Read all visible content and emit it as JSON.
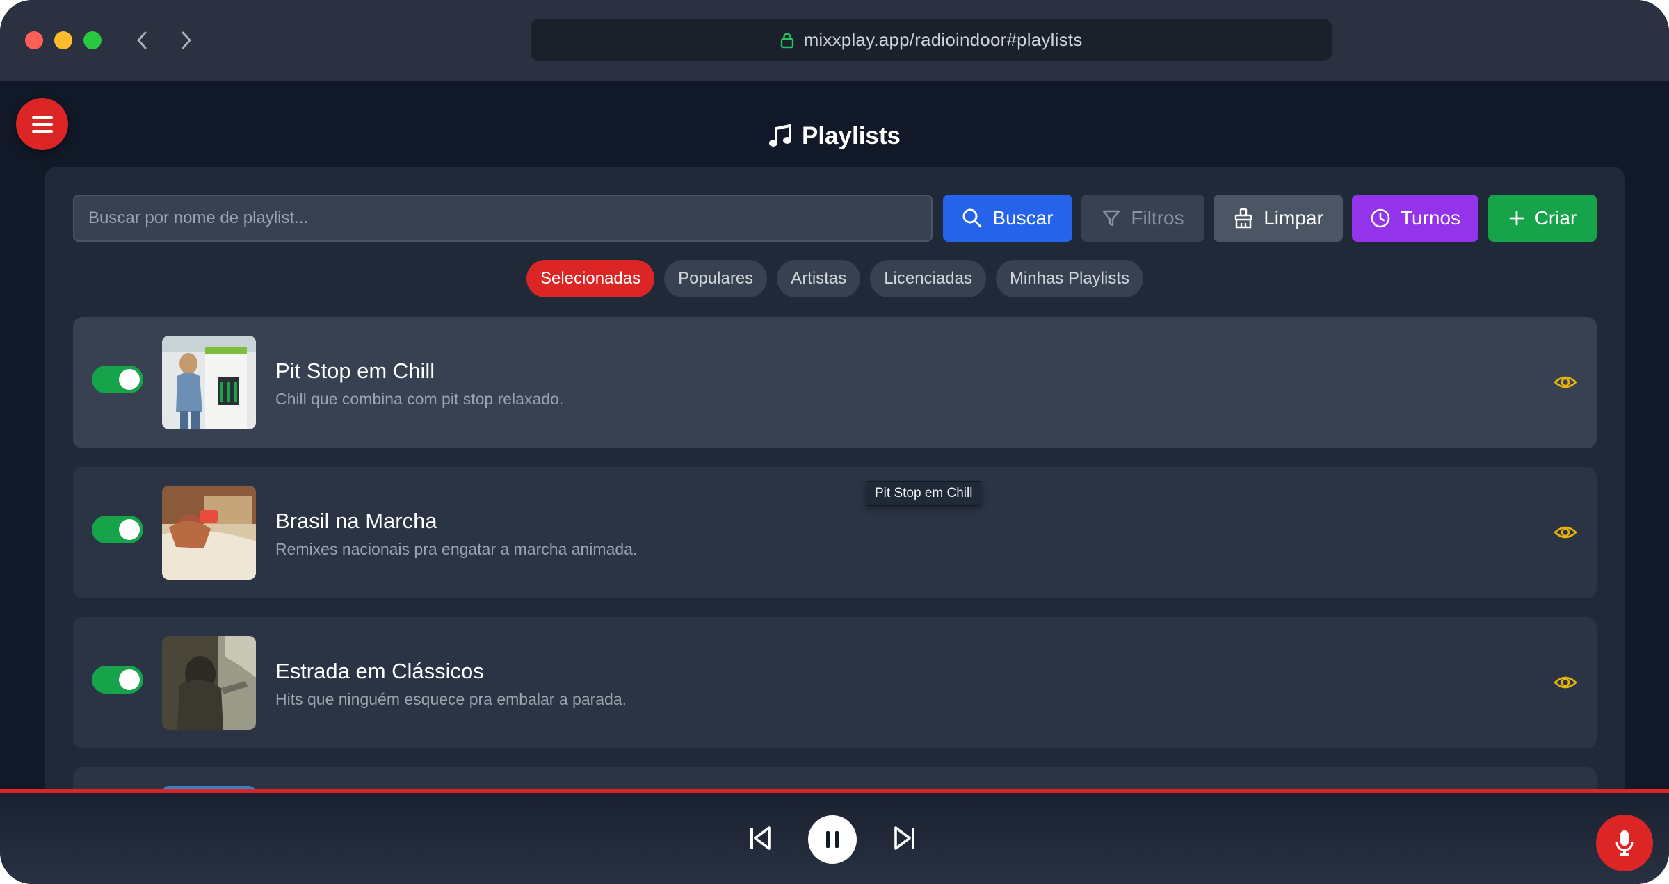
{
  "browser": {
    "url": "mixxplay.app/radioindoor#playlists"
  },
  "page": {
    "title": "Playlists"
  },
  "toolbar": {
    "search_placeholder": "Buscar por nome de playlist...",
    "buscar_label": "Buscar",
    "filtros_label": "Filtros",
    "limpar_label": "Limpar",
    "turnos_label": "Turnos",
    "criar_label": "Criar"
  },
  "tabs": [
    {
      "label": "Selecionadas",
      "active": true
    },
    {
      "label": "Populares",
      "active": false
    },
    {
      "label": "Artistas",
      "active": false
    },
    {
      "label": "Licenciadas",
      "active": false
    },
    {
      "label": "Minhas Playlists",
      "active": false
    }
  ],
  "playlists": [
    {
      "title": "Pit Stop em Chill",
      "description": "Chill que combina com pit stop relaxado.",
      "enabled": true
    },
    {
      "title": "Brasil na Marcha",
      "description": "Remixes nacionais pra engatar a marcha animada.",
      "enabled": true
    },
    {
      "title": "Estrada em Clássicos",
      "description": "Hits que ninguém esquece pra embalar a parada.",
      "enabled": true
    }
  ],
  "tooltip": {
    "text": "Pit Stop em Chill"
  },
  "icons": {
    "menu": "hamburger-icon",
    "title": "music-note-icon",
    "buscar": "search-icon",
    "filtros": "filter-icon",
    "limpar": "broom-icon",
    "turnos": "clock-icon",
    "criar": "plus-icon",
    "view": "eye-icon",
    "prev": "skip-back-icon",
    "pause": "pause-icon",
    "next": "skip-forward-icon",
    "mic": "microphone-icon"
  },
  "colors": {
    "accent_red": "#dc2626",
    "buscar_blue": "#2563eb",
    "turnos_purple": "#9333ea",
    "criar_green": "#16a34a",
    "toggle_on": "#16a34a",
    "eye_yellow": "#eab308"
  }
}
